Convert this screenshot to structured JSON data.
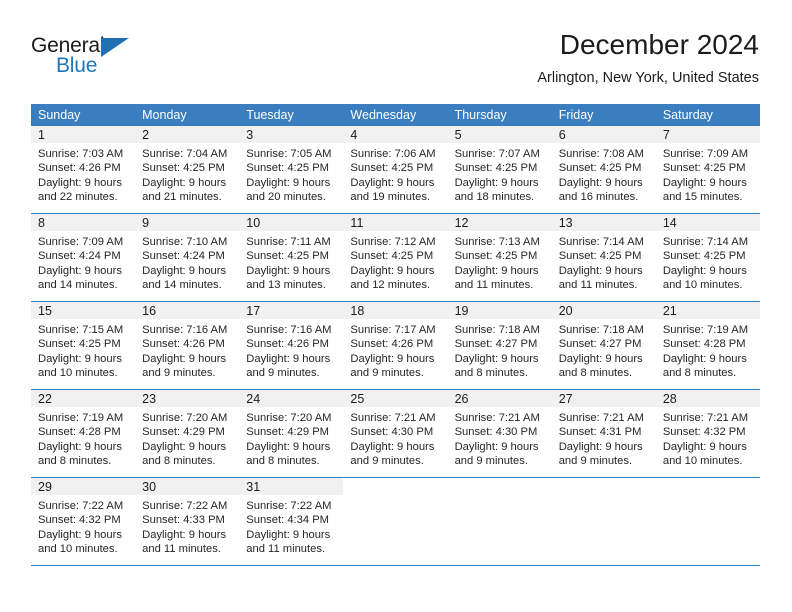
{
  "brand": {
    "name_part1": "General",
    "name_part2": "Blue",
    "accent_color": "#2077bb",
    "triangle_color": "#1f6fb2"
  },
  "header": {
    "title": "December 2024",
    "location": "Arlington, New York, United States"
  },
  "calendar": {
    "header_bg": "#3b7ec0",
    "daynum_bg": "#f1f1f1",
    "weekday_labels": [
      "Sunday",
      "Monday",
      "Tuesday",
      "Wednesday",
      "Thursday",
      "Friday",
      "Saturday"
    ],
    "weeks": [
      [
        {
          "day": "1",
          "sunrise": "Sunrise: 7:03 AM",
          "sunset": "Sunset: 4:26 PM",
          "daylight1": "Daylight: 9 hours",
          "daylight2": "and 22 minutes."
        },
        {
          "day": "2",
          "sunrise": "Sunrise: 7:04 AM",
          "sunset": "Sunset: 4:25 PM",
          "daylight1": "Daylight: 9 hours",
          "daylight2": "and 21 minutes."
        },
        {
          "day": "3",
          "sunrise": "Sunrise: 7:05 AM",
          "sunset": "Sunset: 4:25 PM",
          "daylight1": "Daylight: 9 hours",
          "daylight2": "and 20 minutes."
        },
        {
          "day": "4",
          "sunrise": "Sunrise: 7:06 AM",
          "sunset": "Sunset: 4:25 PM",
          "daylight1": "Daylight: 9 hours",
          "daylight2": "and 19 minutes."
        },
        {
          "day": "5",
          "sunrise": "Sunrise: 7:07 AM",
          "sunset": "Sunset: 4:25 PM",
          "daylight1": "Daylight: 9 hours",
          "daylight2": "and 18 minutes."
        },
        {
          "day": "6",
          "sunrise": "Sunrise: 7:08 AM",
          "sunset": "Sunset: 4:25 PM",
          "daylight1": "Daylight: 9 hours",
          "daylight2": "and 16 minutes."
        },
        {
          "day": "7",
          "sunrise": "Sunrise: 7:09 AM",
          "sunset": "Sunset: 4:25 PM",
          "daylight1": "Daylight: 9 hours",
          "daylight2": "and 15 minutes."
        }
      ],
      [
        {
          "day": "8",
          "sunrise": "Sunrise: 7:09 AM",
          "sunset": "Sunset: 4:24 PM",
          "daylight1": "Daylight: 9 hours",
          "daylight2": "and 14 minutes."
        },
        {
          "day": "9",
          "sunrise": "Sunrise: 7:10 AM",
          "sunset": "Sunset: 4:24 PM",
          "daylight1": "Daylight: 9 hours",
          "daylight2": "and 14 minutes."
        },
        {
          "day": "10",
          "sunrise": "Sunrise: 7:11 AM",
          "sunset": "Sunset: 4:25 PM",
          "daylight1": "Daylight: 9 hours",
          "daylight2": "and 13 minutes."
        },
        {
          "day": "11",
          "sunrise": "Sunrise: 7:12 AM",
          "sunset": "Sunset: 4:25 PM",
          "daylight1": "Daylight: 9 hours",
          "daylight2": "and 12 minutes."
        },
        {
          "day": "12",
          "sunrise": "Sunrise: 7:13 AM",
          "sunset": "Sunset: 4:25 PM",
          "daylight1": "Daylight: 9 hours",
          "daylight2": "and 11 minutes."
        },
        {
          "day": "13",
          "sunrise": "Sunrise: 7:14 AM",
          "sunset": "Sunset: 4:25 PM",
          "daylight1": "Daylight: 9 hours",
          "daylight2": "and 11 minutes."
        },
        {
          "day": "14",
          "sunrise": "Sunrise: 7:14 AM",
          "sunset": "Sunset: 4:25 PM",
          "daylight1": "Daylight: 9 hours",
          "daylight2": "and 10 minutes."
        }
      ],
      [
        {
          "day": "15",
          "sunrise": "Sunrise: 7:15 AM",
          "sunset": "Sunset: 4:25 PM",
          "daylight1": "Daylight: 9 hours",
          "daylight2": "and 10 minutes."
        },
        {
          "day": "16",
          "sunrise": "Sunrise: 7:16 AM",
          "sunset": "Sunset: 4:26 PM",
          "daylight1": "Daylight: 9 hours",
          "daylight2": "and 9 minutes."
        },
        {
          "day": "17",
          "sunrise": "Sunrise: 7:16 AM",
          "sunset": "Sunset: 4:26 PM",
          "daylight1": "Daylight: 9 hours",
          "daylight2": "and 9 minutes."
        },
        {
          "day": "18",
          "sunrise": "Sunrise: 7:17 AM",
          "sunset": "Sunset: 4:26 PM",
          "daylight1": "Daylight: 9 hours",
          "daylight2": "and 9 minutes."
        },
        {
          "day": "19",
          "sunrise": "Sunrise: 7:18 AM",
          "sunset": "Sunset: 4:27 PM",
          "daylight1": "Daylight: 9 hours",
          "daylight2": "and 8 minutes."
        },
        {
          "day": "20",
          "sunrise": "Sunrise: 7:18 AM",
          "sunset": "Sunset: 4:27 PM",
          "daylight1": "Daylight: 9 hours",
          "daylight2": "and 8 minutes."
        },
        {
          "day": "21",
          "sunrise": "Sunrise: 7:19 AM",
          "sunset": "Sunset: 4:28 PM",
          "daylight1": "Daylight: 9 hours",
          "daylight2": "and 8 minutes."
        }
      ],
      [
        {
          "day": "22",
          "sunrise": "Sunrise: 7:19 AM",
          "sunset": "Sunset: 4:28 PM",
          "daylight1": "Daylight: 9 hours",
          "daylight2": "and 8 minutes."
        },
        {
          "day": "23",
          "sunrise": "Sunrise: 7:20 AM",
          "sunset": "Sunset: 4:29 PM",
          "daylight1": "Daylight: 9 hours",
          "daylight2": "and 8 minutes."
        },
        {
          "day": "24",
          "sunrise": "Sunrise: 7:20 AM",
          "sunset": "Sunset: 4:29 PM",
          "daylight1": "Daylight: 9 hours",
          "daylight2": "and 8 minutes."
        },
        {
          "day": "25",
          "sunrise": "Sunrise: 7:21 AM",
          "sunset": "Sunset: 4:30 PM",
          "daylight1": "Daylight: 9 hours",
          "daylight2": "and 9 minutes."
        },
        {
          "day": "26",
          "sunrise": "Sunrise: 7:21 AM",
          "sunset": "Sunset: 4:30 PM",
          "daylight1": "Daylight: 9 hours",
          "daylight2": "and 9 minutes."
        },
        {
          "day": "27",
          "sunrise": "Sunrise: 7:21 AM",
          "sunset": "Sunset: 4:31 PM",
          "daylight1": "Daylight: 9 hours",
          "daylight2": "and 9 minutes."
        },
        {
          "day": "28",
          "sunrise": "Sunrise: 7:21 AM",
          "sunset": "Sunset: 4:32 PM",
          "daylight1": "Daylight: 9 hours",
          "daylight2": "and 10 minutes."
        }
      ],
      [
        {
          "day": "29",
          "sunrise": "Sunrise: 7:22 AM",
          "sunset": "Sunset: 4:32 PM",
          "daylight1": "Daylight: 9 hours",
          "daylight2": "and 10 minutes."
        },
        {
          "day": "30",
          "sunrise": "Sunrise: 7:22 AM",
          "sunset": "Sunset: 4:33 PM",
          "daylight1": "Daylight: 9 hours",
          "daylight2": "and 11 minutes."
        },
        {
          "day": "31",
          "sunrise": "Sunrise: 7:22 AM",
          "sunset": "Sunset: 4:34 PM",
          "daylight1": "Daylight: 9 hours",
          "daylight2": "and 11 minutes."
        },
        {
          "day": "",
          "sunrise": "",
          "sunset": "",
          "daylight1": "",
          "daylight2": ""
        },
        {
          "day": "",
          "sunrise": "",
          "sunset": "",
          "daylight1": "",
          "daylight2": ""
        },
        {
          "day": "",
          "sunrise": "",
          "sunset": "",
          "daylight1": "",
          "daylight2": ""
        },
        {
          "day": "",
          "sunrise": "",
          "sunset": "",
          "daylight1": "",
          "daylight2": ""
        }
      ]
    ]
  }
}
